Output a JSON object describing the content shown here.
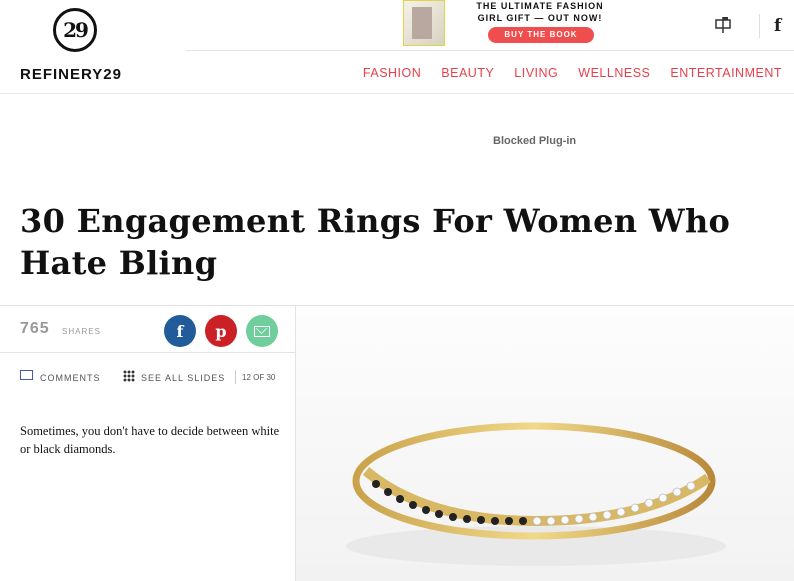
{
  "header": {
    "logo_mark": "29",
    "logo_word": "REFINERY29",
    "promo_line1": "THE ULTIMATE FASHION",
    "promo_line2": "GIRL GIFT — OUT NOW!",
    "promo_button": "BUY THE BOOK",
    "facebook_glyph": "f",
    "nav": [
      "FASHION",
      "BEAUTY",
      "LIVING",
      "WELLNESS",
      "ENTERTAINMENT"
    ]
  },
  "plugin_text": "Blocked Plug-in",
  "article": {
    "title": "30 Engagement Rings For Women Who Hate Bling",
    "shares_count": "765",
    "shares_label": "SHARES",
    "social": {
      "facebook": "f",
      "pinterest": "p"
    },
    "comments_label": "COMMENTS",
    "see_all_label": "SEE ALL SLIDES",
    "slide_counter": "12 OF 30",
    "caption": "Sometimes, you don't have to decide between white or black diamonds."
  },
  "colors": {
    "nav_red": "#e8404a",
    "facebook_blue": "#225b99",
    "pinterest_red": "#cc2027",
    "email_green": "#6fce9c",
    "promo_button": "#f04e4e"
  }
}
